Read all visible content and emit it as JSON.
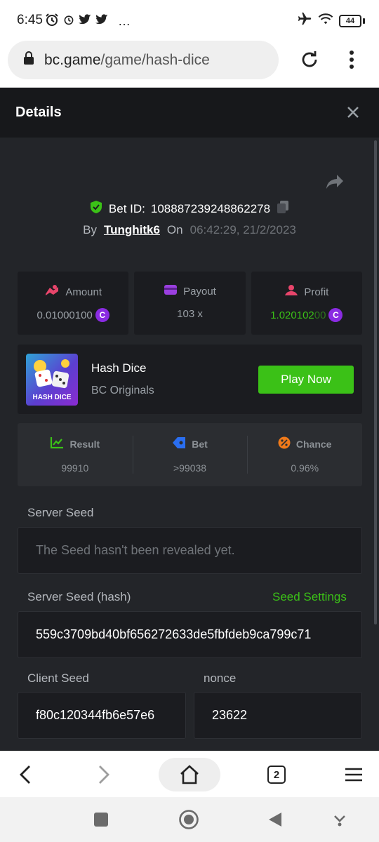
{
  "status_bar": {
    "time": "6:45",
    "battery": "44",
    "overflow": "…"
  },
  "url_bar": {
    "domain": "bc.game",
    "path": "/game/hash-dice"
  },
  "details": {
    "title": "Details",
    "bet_id_label": "Bet ID:",
    "bet_id": "108887239248862278",
    "by_label": "By",
    "username": "Tunghitk6",
    "on_label": "On",
    "datetime": "06:42:29, 21/2/2023"
  },
  "stats": {
    "amount": {
      "label": "Amount",
      "value_main": "0.01000100",
      "value_dim": ""
    },
    "payout": {
      "label": "Payout",
      "value": "103 x"
    },
    "profit": {
      "label": "Profit",
      "value_main": "1.020102",
      "value_dim": "00"
    },
    "coin_symbol": "C"
  },
  "game": {
    "thumb_caption": "HASH DICE",
    "name": "Hash Dice",
    "provider": "BC Originals",
    "play_label": "Play Now"
  },
  "result": {
    "result_label": "Result",
    "result_value": "99910",
    "bet_label": "Bet",
    "bet_value": ">99038",
    "chance_label": "Chance",
    "chance_value": "0.96%"
  },
  "seeds": {
    "server_seed_label": "Server Seed",
    "server_seed_value": "The Seed hasn't been revealed yet.",
    "server_hash_label": "Server Seed (hash)",
    "seed_settings_label": "Seed Settings",
    "server_hash_value": "559c3709bd40bf656272633de5fbfdeb9ca799c71",
    "client_seed_label": "Client Seed",
    "client_seed_value": "f80c120344fb6e57e6",
    "nonce_label": "nonce",
    "nonce_value": "23622"
  },
  "toolbar": {
    "tab_count": "2"
  },
  "colors": {
    "accent_green": "#3bc117",
    "coin_purple": "#8a2be2",
    "panel_bg": "#1b1c20",
    "page_bg": "#232529"
  }
}
